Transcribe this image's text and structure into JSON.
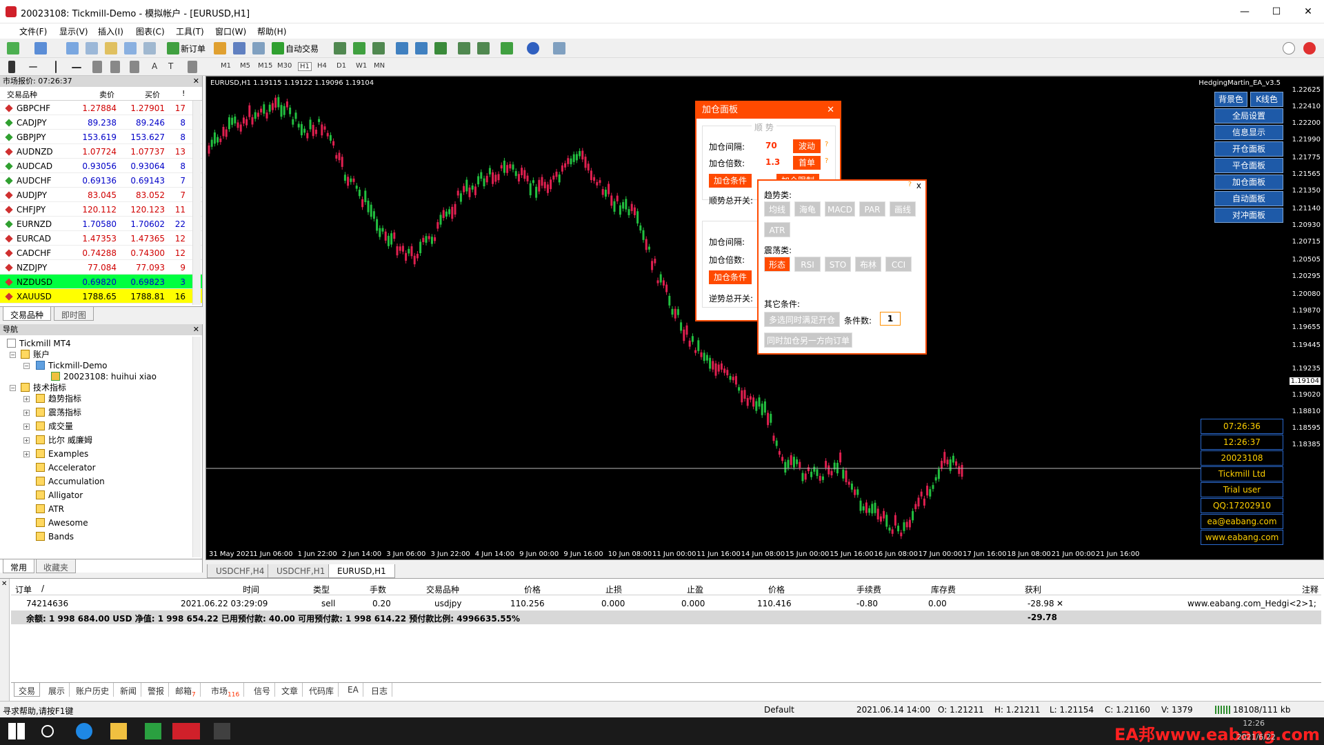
{
  "window": {
    "title": "20023108: Tickmill-Demo - 模拟帐户 - [EURUSD,H1]",
    "min": "—",
    "max": "☐",
    "close": "✕"
  },
  "menu": [
    "文件(F)",
    "显示(V)",
    "插入(I)",
    "图表(C)",
    "工具(T)",
    "窗口(W)",
    "帮助(H)"
  ],
  "toolbar": {
    "new_order": "新订单",
    "auto_trade": "自动交易",
    "timeframes": [
      "M1",
      "M5",
      "M15",
      "M30",
      "H1",
      "H4",
      "D1",
      "W1",
      "MN"
    ]
  },
  "market_watch": {
    "title": "市场报价: 07:26:37",
    "cols": [
      "交易品种",
      "卖价",
      "买价",
      "!"
    ],
    "rows": [
      {
        "sym": "GBPCHF",
        "bid": "1.27884",
        "ask": "1.27901",
        "spr": "17",
        "dir": "down"
      },
      {
        "sym": "CADJPY",
        "bid": "89.238",
        "ask": "89.246",
        "spr": "8",
        "dir": "up"
      },
      {
        "sym": "GBPJPY",
        "bid": "153.619",
        "ask": "153.627",
        "spr": "8",
        "dir": "up"
      },
      {
        "sym": "AUDNZD",
        "bid": "1.07724",
        "ask": "1.07737",
        "spr": "13",
        "dir": "down"
      },
      {
        "sym": "AUDCAD",
        "bid": "0.93056",
        "ask": "0.93064",
        "spr": "8",
        "dir": "up"
      },
      {
        "sym": "AUDCHF",
        "bid": "0.69136",
        "ask": "0.69143",
        "spr": "7",
        "dir": "up"
      },
      {
        "sym": "AUDJPY",
        "bid": "83.045",
        "ask": "83.052",
        "spr": "7",
        "dir": "down"
      },
      {
        "sym": "CHFJPY",
        "bid": "120.112",
        "ask": "120.123",
        "spr": "11",
        "dir": "down"
      },
      {
        "sym": "EURNZD",
        "bid": "1.70580",
        "ask": "1.70602",
        "spr": "22",
        "dir": "up"
      },
      {
        "sym": "EURCAD",
        "bid": "1.47353",
        "ask": "1.47365",
        "spr": "12",
        "dir": "down"
      },
      {
        "sym": "CADCHF",
        "bid": "0.74288",
        "ask": "0.74300",
        "spr": "12",
        "dir": "down"
      },
      {
        "sym": "NZDJPY",
        "bid": "77.084",
        "ask": "77.093",
        "spr": "9",
        "dir": "down"
      },
      {
        "sym": "NZDUSD",
        "bid": "0.69820",
        "ask": "0.69823",
        "spr": "3",
        "dir": "hl-green"
      },
      {
        "sym": "XAUUSD",
        "bid": "1788.65",
        "ask": "1788.81",
        "spr": "16",
        "dir": "hl-yellow"
      }
    ],
    "tabs": [
      "交易品种",
      "即时图"
    ]
  },
  "navigator": {
    "title": "导航",
    "items": [
      "Tickmill MT4",
      "账户",
      "Tickmill-Demo",
      "20023108: huihui xiao",
      "技术指标",
      "趋势指标",
      "震荡指标",
      "成交量",
      "比尔 威廉姆",
      "Examples",
      "Accelerator",
      "Accumulation",
      "Alligator",
      "ATR",
      "Awesome",
      "Bands"
    ],
    "tabs": [
      "常用",
      "收藏夹"
    ]
  },
  "chart": {
    "label": "EURUSD,H1  1.19115 1.19122 1.19096 1.19104",
    "ea": "HedgingMartin_EA_v3.5",
    "prices": [
      "1.22625",
      "1.22410",
      "1.22200",
      "1.21990",
      "1.21775",
      "1.21565",
      "1.21350",
      "1.21140",
      "1.20930",
      "1.20715",
      "1.20505",
      "1.20295",
      "1.20080",
      "1.19870",
      "1.19655",
      "1.19445",
      "1.19235",
      "1.19104",
      "1.19020",
      "1.18810",
      "1.18595",
      "1.18385"
    ],
    "times": [
      "31 May 2021",
      "1 Jun 06:00",
      "1 Jun 22:00",
      "2 Jun 14:00",
      "3 Jun 06:00",
      "3 Jun 22:00",
      "4 Jun 14:00",
      "9 Jun 00:00",
      "9 Jun 16:00",
      "10 Jun 08:00",
      "11 Jun 00:00",
      "11 Jun 16:00",
      "14 Jun 08:00",
      "15 Jun 00:00",
      "15 Jun 16:00",
      "16 Jun 08:00",
      "17 Jun 00:00",
      "17 Jun 16:00",
      "18 Jun 08:00",
      "21 Jun 00:00",
      "21 Jun 16:00"
    ],
    "right_buttons": [
      "背景色",
      "K线色",
      "全局设置",
      "信息显示",
      "开仓面板",
      "平仓面板",
      "加仓面板",
      "自动面板",
      "对冲面板"
    ],
    "info": [
      "07:26:36",
      "12:26:37",
      "20023108",
      "Tickmill Ltd",
      "Trial user",
      "QQ:17202910",
      "ea@eabang.com",
      "www.eabang.com"
    ],
    "tabs": [
      "USDCHF,H4",
      "USDCHF,H1",
      "EURUSD,H1"
    ]
  },
  "panel1": {
    "title": "加仓面板",
    "section1": "顺 势",
    "interval_label": "加仓间隔:",
    "interval_val": "70",
    "interval_btn": "波动",
    "mult_label": "加仓倍数:",
    "mult_val": "1.3",
    "mult_btn": "首单",
    "cond_btn": "加仓条件",
    "limit_btn": "加仓限制",
    "trend_switch": "顺势总开关:",
    "interval_label2": "加仓间隔:",
    "mult_label2": "加仓倍数:",
    "cond_btn2": "加仓条件",
    "counter_switch": "逆势总开关:",
    "q": "?"
  },
  "panel2": {
    "trend_title": "趋势类:",
    "trend": [
      "均线",
      "海龟",
      "MACD",
      "PAR",
      "画线",
      "ATR"
    ],
    "osc_title": "震荡类:",
    "osc": [
      "形态",
      "RSI",
      "STO",
      "布林",
      "CCI"
    ],
    "other_title": "其它条件:",
    "multi_btn": "多选同时满足开仓",
    "count_label": "条件数:",
    "count_val": "1",
    "hedge_btn": "同时加仓另一方向订单",
    "close": "x",
    "q": "?"
  },
  "terminal": {
    "headers": [
      "订单",
      "/",
      "时间",
      "类型",
      "手数",
      "交易品种",
      "价格",
      "止损",
      "止盈",
      "价格",
      "手续费",
      "库存费",
      "获利",
      "注释"
    ],
    "row": {
      "order": "74214636",
      "time": "2021.06.22 03:29:09",
      "type": "sell",
      "lots": "0.20",
      "sym": "usdjpy",
      "price": "110.256",
      "sl": "0.000",
      "tp": "0.000",
      "cur": "110.416",
      "comm": "-0.80",
      "swap": "0.00",
      "profit": "-28.98",
      "comment": "www.eabang.com_Hedgi<2>1;"
    },
    "balance": "余额: 1 998 684.00 USD  净值: 1 998 654.22  已用预付款: 40.00  可用预付款: 1 998 614.22  预付款比例: 4996635.55%",
    "total": "-29.78",
    "tabs": [
      "交易",
      "展示",
      "账户历史",
      "新闻",
      "警报",
      "邮箱",
      "市场",
      "信号",
      "文章",
      "代码库",
      "EA",
      "日志"
    ],
    "badges": {
      "邮箱": "7",
      "市场": "116"
    }
  },
  "status": {
    "help": "寻求帮助,请按F1键",
    "profile": "Default",
    "time": "2021.06.14 14:00",
    "o": "O: 1.21211",
    "h": "H: 1.21211",
    "l": "L: 1.21154",
    "c": "C: 1.21160",
    "v": "V: 1379",
    "traffic": "18108/111 kb"
  },
  "taskbar": {
    "watermark": "EA邦www.eabang.com",
    "clock": "12:26",
    "date": "2021/6/22"
  }
}
